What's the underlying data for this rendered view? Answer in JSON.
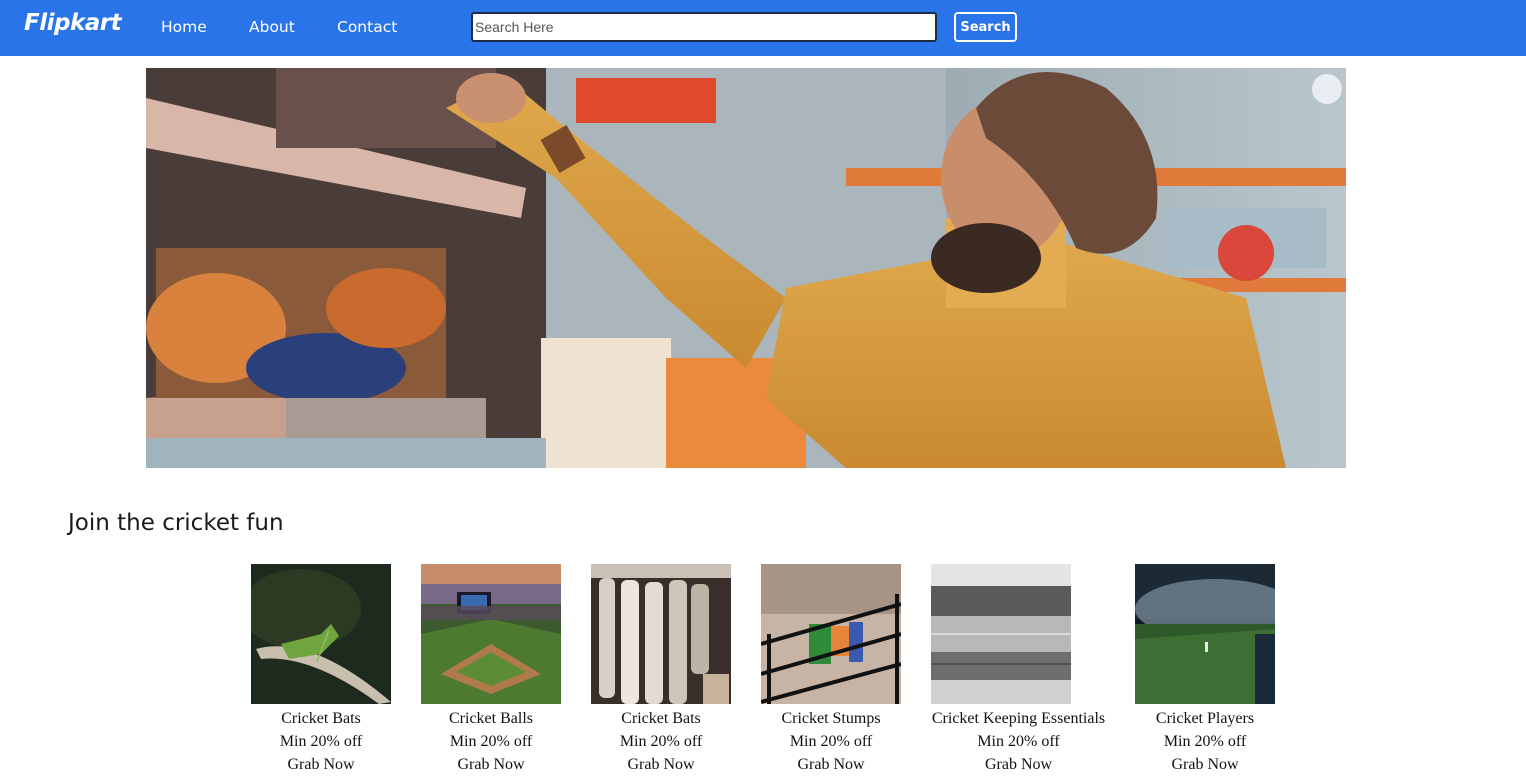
{
  "nav": {
    "brand": "Flipkart",
    "links": [
      "Home",
      "About",
      "Contact"
    ],
    "search_placeholder": "Search Here",
    "search_button": "Search"
  },
  "section": {
    "title": "Join the cricket fun"
  },
  "products": [
    {
      "name": "Cricket Bats",
      "offer": "Min 20% off",
      "cta": "Grab Now"
    },
    {
      "name": "Cricket Balls",
      "offer": "Min 20% off",
      "cta": "Grab Now"
    },
    {
      "name": "Cricket Bats",
      "offer": "Min 20% off",
      "cta": "Grab Now"
    },
    {
      "name": "Cricket Stumps",
      "offer": "Min 20% off",
      "cta": "Grab Now"
    },
    {
      "name": "Cricket Keeping Essentials",
      "offer": "Min 20% off",
      "cta": "Grab Now"
    },
    {
      "name": "Cricket Players",
      "offer": "Min 20% off",
      "cta": "Grab Now"
    }
  ],
  "colors": {
    "navbar": "#2a74ea"
  },
  "icons": {
    "hero_overlay": "visual-search-icon"
  }
}
